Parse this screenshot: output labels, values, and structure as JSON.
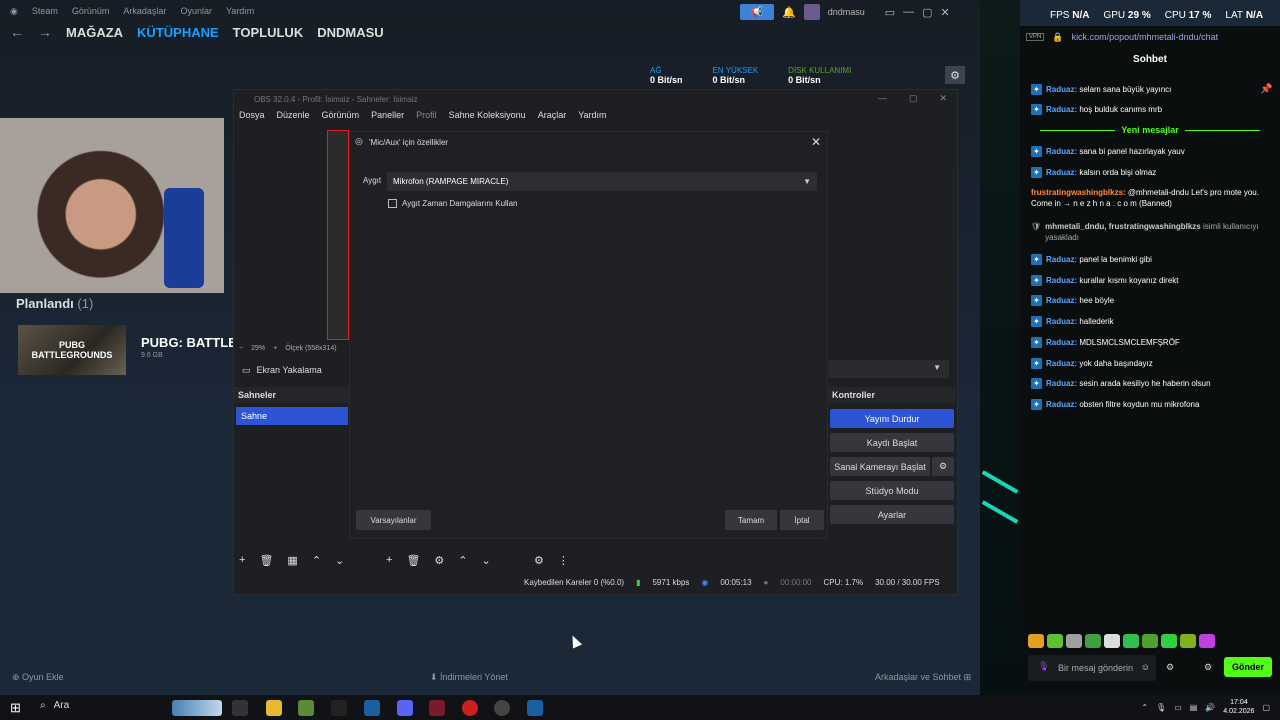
{
  "steam": {
    "menu": [
      "Steam",
      "Görünüm",
      "Arkadaşlar",
      "Oyunlar",
      "Yardım"
    ],
    "tabs": [
      "MAĞAZA",
      "KÜTÜPHANE",
      "TOPLULUK",
      "DNDMASU"
    ],
    "username": "dndmasu",
    "net": [
      {
        "label": "AĞ",
        "value": "0 Bit/sn"
      },
      {
        "label": "EN YÜKSEK",
        "value": "0 Bit/sn"
      },
      {
        "label": "DİSK KULLANIMI",
        "value": "0 Bit/sn"
      }
    ],
    "planned_label": "Planlandı",
    "planned_count": "(1)",
    "game_title": "PUBG: BATTLEGROUNDS",
    "game_thumb_text": "PUBG BATTLEGROUNDS",
    "game_size": "9.6 GB",
    "add_game": "Oyun Ekle",
    "manage_downloads": "İndirmeleri Yönet",
    "friends_chat": "Arkadaşlar ve Sohbet"
  },
  "obs": {
    "title": "OBS 32.0.4 - Profil: İsimsiz - Sahneler: İsimsiz",
    "menu": [
      "Dosya",
      "Düzenle",
      "Görünüm",
      "Paneller",
      "Profil",
      "Sahne Koleksiyonu",
      "Araçlar",
      "Yardım"
    ],
    "zoom": "29%",
    "scale": "Ölçek (558x314)",
    "source": "Ekran Yakalama",
    "scenes_header": "Sahneler",
    "scene_item": "Sahne",
    "controls_header": "Kontroller",
    "controls": [
      "Yayını Durdur",
      "Kaydı Başlat",
      "Sanal Kamerayı Başlat",
      "Stüdyo Modu",
      "Ayarlar"
    ],
    "status": {
      "dropped": "Kaybedilen Kareler 0 (%0.0)",
      "bitrate": "5971 kbps",
      "stream_time": "00:05:13",
      "rec_time": "00:00:00",
      "cpu": "CPU: 1.7%",
      "fps": "30.00 / 30.00 FPS"
    }
  },
  "dialog": {
    "title": "'Mic/Aux' için özellikler",
    "device_label": "Aygıt",
    "device_value": "Mikrofon (RAMPAGE MIRACLE)",
    "checkbox_label": "Aygıt Zaman Damgalarını Kullan",
    "defaults_btn": "Varsayılanlar",
    "ok_btn": "Tamam",
    "cancel_btn": "İptal"
  },
  "hud": {
    "fps_label": "FPS",
    "fps": "N/A",
    "gpu_label": "GPU",
    "gpu": "29 %",
    "cpu_label": "CPU",
    "cpu": "17 %",
    "lat_label": "LAT",
    "lat": "N/A"
  },
  "chat": {
    "url": "kick.com/popout/mhmetali-dndu/chat",
    "vpn": "VPN",
    "header": "Sohbet",
    "new_messages": "Yeni mesajlar",
    "messages_before": [
      {
        "user": "Raduaz:",
        "text": "selam sana büyük yayıncı"
      },
      {
        "user": "Raduaz:",
        "text": "hoş bulduk canıms mrb"
      }
    ],
    "messages_after": [
      {
        "user": "Raduaz:",
        "text": "sana bi panel hazırlayak yauv"
      },
      {
        "user": "Raduaz:",
        "text": "kalsın orda bişi olmaz"
      }
    ],
    "spam_user": "frustratingwashingblkzs:",
    "spam_text": "@mhmetali-dndu Let's pro mote you. Come in → n e z h n a . c o m (Banned)",
    "ban_notice_users": "mhmetali_dndu, frustratingwashingblkzs",
    "ban_notice_text": "isimli kullanıcıyı yasakladı",
    "messages_end": [
      {
        "user": "Raduaz:",
        "text": "panel la benimki gibi"
      },
      {
        "user": "Raduaz:",
        "text": "kurallar kısmı koyanız direkt"
      },
      {
        "user": "Raduaz:",
        "text": "hee böyle"
      },
      {
        "user": "Raduaz:",
        "text": "hallederik"
      },
      {
        "user": "Raduaz:",
        "text": "MDLSMCLSMCLEMFŞRÖF"
      },
      {
        "user": "Raduaz:",
        "text": "yok daha başındayız"
      },
      {
        "user": "Raduaz:",
        "text": "sesin arada kesiliyo he haberin olsun"
      },
      {
        "user": "Raduaz:",
        "text": "obsten filtre koydun mu mikrofona"
      }
    ],
    "input_placeholder": "Bir mesaj gönderin",
    "send": "Gönder"
  },
  "taskbar": {
    "search": "Ara",
    "time": "17:04",
    "date": "4.02.2026"
  }
}
